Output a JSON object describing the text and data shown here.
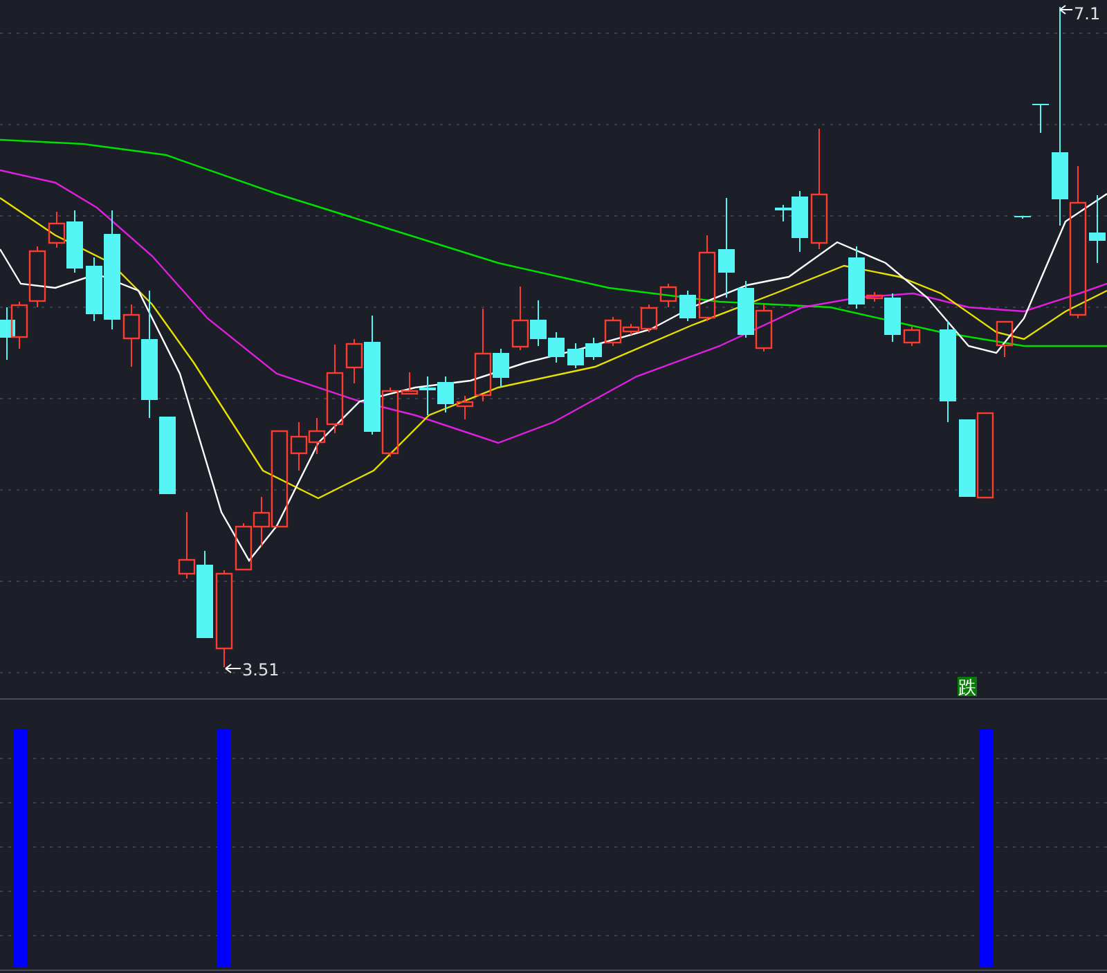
{
  "price_chart": {
    "high_label": "7.1",
    "low_label": "3.51"
  },
  "indicator_panel": {
    "signal_label": "跌"
  }
}
